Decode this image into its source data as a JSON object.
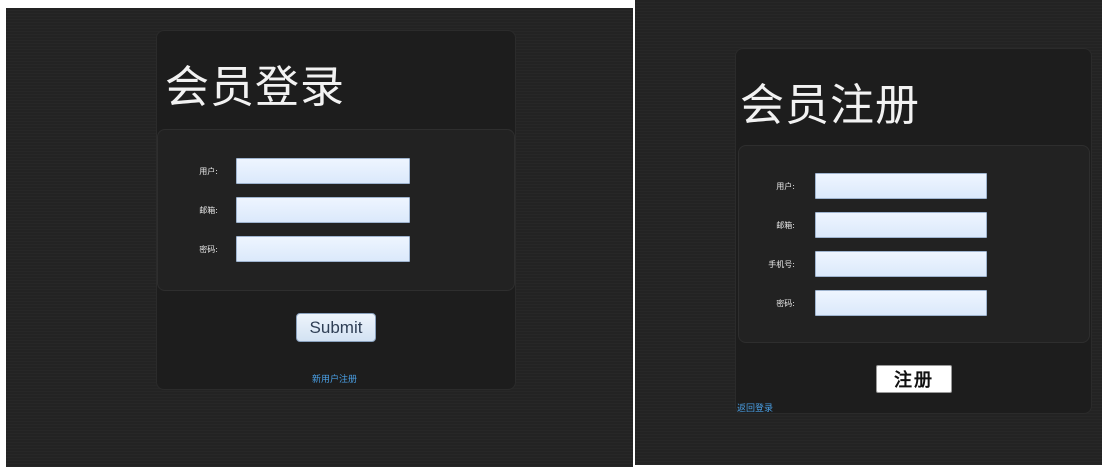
{
  "login": {
    "title": "会员登录",
    "fields": [
      {
        "label": "用户:",
        "value": ""
      },
      {
        "label": "邮箱:",
        "value": ""
      },
      {
        "label": "密码:",
        "value": ""
      }
    ],
    "submit_label": "Submit",
    "register_link": "新用户注册"
  },
  "register": {
    "title": "会员注册",
    "fields": [
      {
        "label": "用户:",
        "value": ""
      },
      {
        "label": "邮箱:",
        "value": ""
      },
      {
        "label": "手机号:",
        "value": ""
      },
      {
        "label": "密码:",
        "value": ""
      }
    ],
    "submit_label": "注册",
    "back_link": "返回登录"
  }
}
